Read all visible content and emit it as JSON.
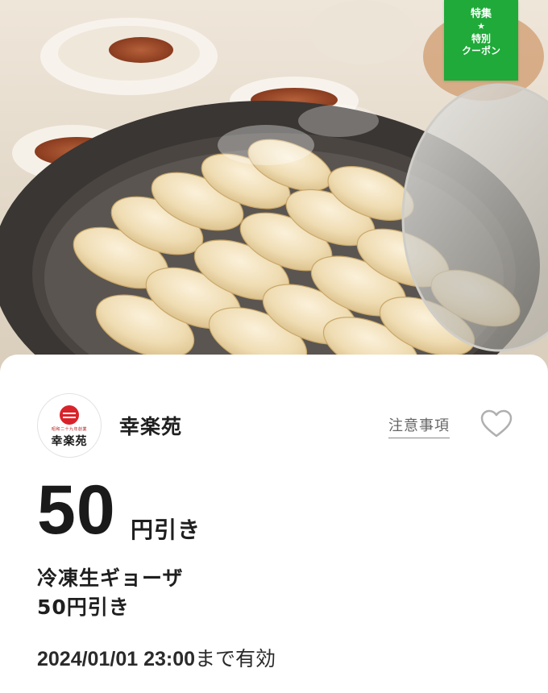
{
  "badge": {
    "title": "特集",
    "star": "★",
    "line1": "特別",
    "line2": "クーポン",
    "color": "#1faa39"
  },
  "shop": {
    "name": "幸楽苑",
    "logo_small_text": "昭和二十九年創業",
    "logo_name": "幸楽苑",
    "logo_color": "#d8232a"
  },
  "links": {
    "notice": "注意事項"
  },
  "icons": {
    "favorite": "heart-outline-icon"
  },
  "coupon": {
    "discount_amount": "50",
    "discount_unit": "円引き",
    "item_name": "冷凍生ギョーザ",
    "item_detail": "50円引き",
    "expiry_datetime": "2024/01/01 23:00",
    "expiry_suffix": "まで有効"
  }
}
